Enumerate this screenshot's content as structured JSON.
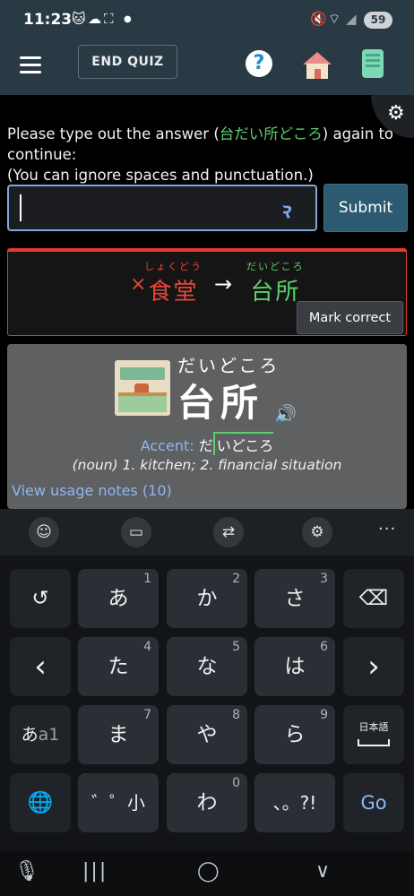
{
  "status_bar": {
    "time": "11:23",
    "battery": "59",
    "icons": [
      "cat-icon",
      "cloud-icon",
      "screenshot-icon",
      "dot-icon",
      "mute-icon",
      "wifi-icon",
      "signal-icon"
    ]
  },
  "app_bar": {
    "end_quiz_label": "END QUIZ",
    "help_symbol": "?"
  },
  "prompt": {
    "text_before": "Please type out the answer (",
    "answer": "台だい所どころ",
    "text_after": ") again to continue:",
    "note": "(You can ignore spaces and punctuation.)"
  },
  "input": {
    "value": "",
    "placeholder": "",
    "submit_label": "Submit"
  },
  "mistake": {
    "wrong_word": "食堂",
    "wrong_reading": "しょくどう",
    "right_word": "台所",
    "right_reading": "だいどころ",
    "x_symbol": "×",
    "arrow_symbol": "→",
    "mark_correct_label": "Mark correct",
    "border_color": "#e23a2e"
  },
  "vocab_card": {
    "reading": "だいどころ",
    "word": "台所",
    "accent_label": "Accent:",
    "accent_low": "だ",
    "accent_high": "いどころ",
    "definition": "(noun) 1. kitchen; 2. financial situation",
    "usage_link": "View usage notes (10)"
  },
  "keyboard": {
    "toolbar": [
      "emoji-icon",
      "clipboard-icon",
      "translate-icon",
      "settings-icon",
      "more-icon"
    ],
    "more_symbol": "···",
    "keys": {
      "undo": "↺",
      "a": "あ",
      "ka": "か",
      "sa": "さ",
      "left": "‹",
      "ta": "た",
      "na": "な",
      "ha": "は",
      "right": "›",
      "mode": "あ",
      "mode_small": "a1",
      "ma": "ま",
      "ya": "や",
      "ra": "ら",
      "nihongo": "日本語",
      "globe": "🌐",
      "dakuten": "゛゜小",
      "wa": "わ",
      "punct": "、。?!",
      "go": "Go"
    },
    "hints": {
      "a": "1",
      "ka": "2",
      "sa": "3",
      "ta": "4",
      "na": "5",
      "ha": "6",
      "ma": "7",
      "ya": "8",
      "ra": "9",
      "wa": "0"
    }
  },
  "nav_bar": [
    "mic-icon",
    "recents-icon",
    "home-icon",
    "back-icon"
  ]
}
